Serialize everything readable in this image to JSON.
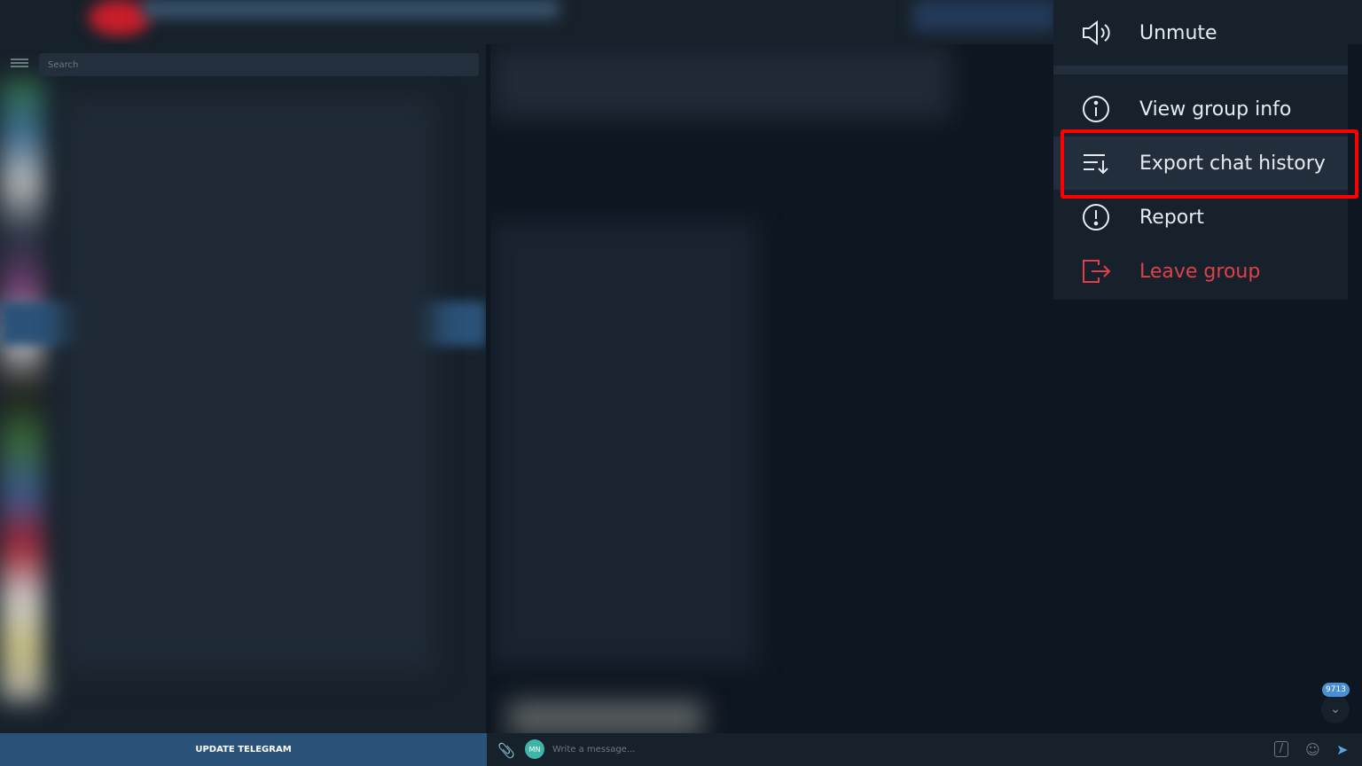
{
  "sidebar": {
    "search_placeholder": "Search",
    "update_button": "UPDATE TELEGRAM"
  },
  "composer": {
    "avatar_initials": "MN",
    "placeholder": "Write a message..."
  },
  "scroll": {
    "unread_count": "9713"
  },
  "context_menu": {
    "items": [
      {
        "label": "Unmute",
        "icon": "speaker-icon"
      },
      {
        "label": "View group info",
        "icon": "info-icon"
      },
      {
        "label": "Export chat history",
        "icon": "export-list-icon",
        "highlighted": true
      },
      {
        "label": "Report",
        "icon": "alert-icon"
      },
      {
        "label": "Leave group",
        "icon": "leave-icon",
        "danger": true
      }
    ]
  },
  "colors": {
    "danger": "#e0404a",
    "highlight_box": "#ff0000",
    "accent": "#2b5278"
  }
}
